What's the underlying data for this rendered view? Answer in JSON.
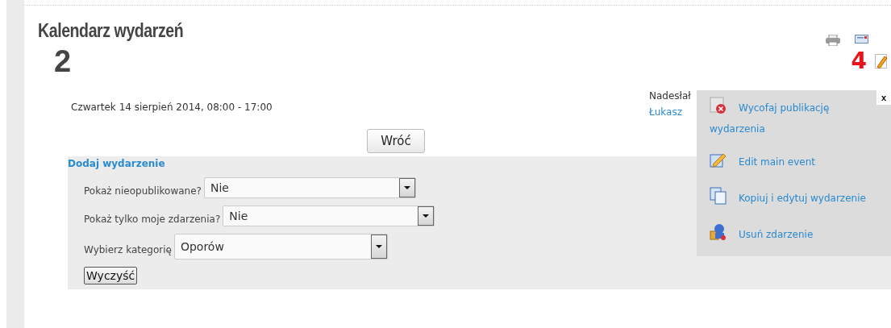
{
  "page_title": "Kalendarz wydarzeń",
  "event_title": "2",
  "event_date": "Czwartek 14 sierpień 2014, 08:00 - 17:00",
  "author": {
    "label": "Nadesłał",
    "name": "Łukasz"
  },
  "back_button": "Wróć",
  "annotation": "4",
  "form": {
    "title": "Dodaj wydarzenie",
    "selects": [
      {
        "label": "Pokaż nieopublikowane?",
        "value": "Nie"
      },
      {
        "label": "Pokaż tylko moje zdarzenia?",
        "value": "Nie"
      },
      {
        "label": "Wybierz kategorię",
        "value": "Oporów"
      }
    ],
    "clear_button": "Wyczyść"
  },
  "popup_menu": {
    "close": "x",
    "items": [
      {
        "kind": "unpublish",
        "label": "Wycofaj publikację wydarzenia"
      },
      {
        "kind": "edit",
        "label": "Edit main event"
      },
      {
        "kind": "copy",
        "label": "Kopiuj i edytuj wydarzenie"
      },
      {
        "kind": "delete",
        "label": "Usuń zdarzenie"
      }
    ]
  }
}
